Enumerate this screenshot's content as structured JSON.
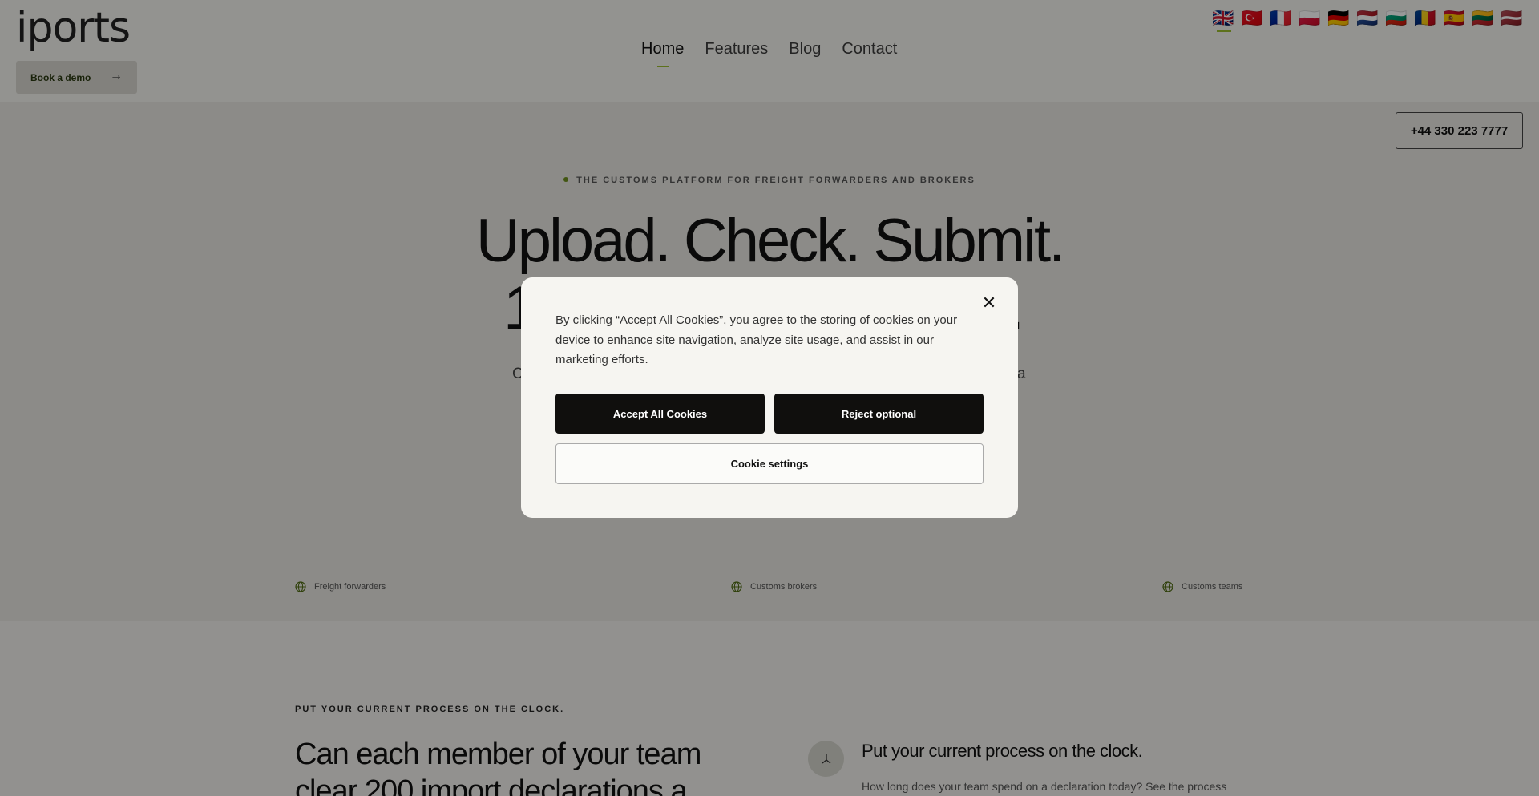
{
  "header": {
    "logo": "iports",
    "demo_button": "Book a demo",
    "nav": [
      {
        "label": "Home",
        "active": true
      },
      {
        "label": "Features",
        "active": false
      },
      {
        "label": "Blog",
        "active": false
      },
      {
        "label": "Contact",
        "active": false
      }
    ],
    "languages": [
      {
        "name": "English",
        "flag": "🇬🇧",
        "active": true
      },
      {
        "name": "Turkish",
        "flag": "🇹🇷",
        "active": false
      },
      {
        "name": "French",
        "flag": "🇫🇷",
        "active": false
      },
      {
        "name": "Polish",
        "flag": "🇵🇱",
        "active": false
      },
      {
        "name": "German",
        "flag": "🇩🇪",
        "active": false
      },
      {
        "name": "Dutch",
        "flag": "🇳🇱",
        "active": false
      },
      {
        "name": "Bulgarian",
        "flag": "🇧🇬",
        "active": false
      },
      {
        "name": "Romanian",
        "flag": "🇷🇴",
        "active": false
      },
      {
        "name": "Spanish",
        "flag": "🇪🇸",
        "active": false
      },
      {
        "name": "Lithuanian",
        "flag": "🇱🇹",
        "active": false
      },
      {
        "name": "Latvian",
        "flag": "🇱🇻",
        "active": false
      }
    ]
  },
  "hero": {
    "phone": "+44 330 223 7777",
    "eyebrow": "THE CUSTOMS PLATFORM FOR FREIGHT FORWARDERS AND BROKERS",
    "title_line1": "Upload. Check. Submit.",
    "title_line2_start": "1",
    "title_line2_end": "k.",
    "subtitle_start": "C",
    "subtitle_end": "a",
    "audiences": [
      "Freight forwarders",
      "Customs brokers",
      "Customs teams"
    ]
  },
  "section": {
    "eyebrow": "PUT YOUR CURRENT PROCESS ON THE CLOCK.",
    "title": "Can each member of your team clear 200 import declarations a",
    "right_title": "Put your current process on the clock.",
    "right_text": "How long does your team spend on a declaration today? See the process"
  },
  "cookie_modal": {
    "text": "By clicking “Accept All Cookies”, you agree to the storing of cookies on your device to enhance site navigation, analyze site usage, and assist in our marketing efforts.",
    "accept": "Accept All Cookies",
    "reject": "Reject optional",
    "settings": "Cookie settings",
    "close_icon": "close-icon"
  },
  "colors": {
    "accent": "#9cbd2f",
    "overlay": "rgba(0,0,0,0.4)",
    "button_dark": "#100f0d"
  }
}
